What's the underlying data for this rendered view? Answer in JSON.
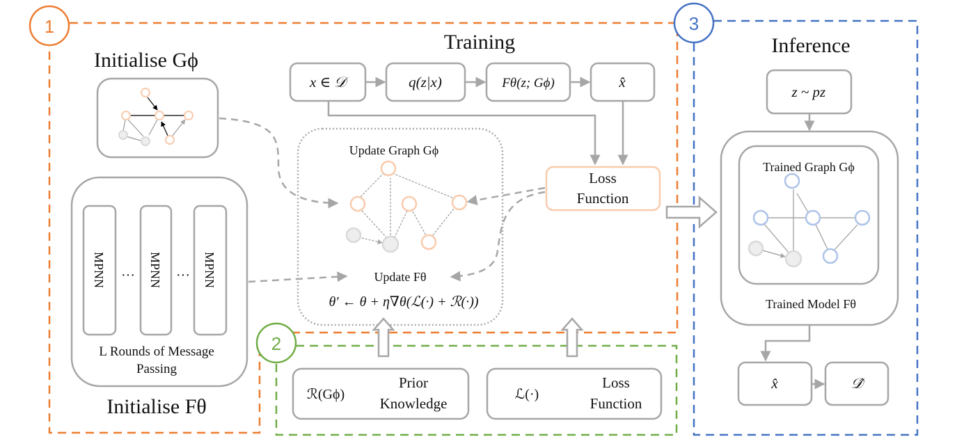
{
  "colors": {
    "stage1": "#ed7d31",
    "stage2": "#70ad47",
    "stage3": "#4472c4",
    "node_orange": "#f8cbad",
    "node_blue": "#adc3e8",
    "node_gray": "#d9d9d9",
    "line": "#a6a6a6"
  },
  "stage_numbers": [
    "1",
    "2",
    "3"
  ],
  "training": {
    "title": "Training",
    "pipeline": [
      "x ∈ 𝒟",
      "q(z|x)",
      "Fθ(z; Gϕ)",
      "x̂"
    ],
    "loss_box": [
      "Loss",
      "Function"
    ],
    "update_graph_label": "Update Graph Gϕ",
    "update_model_label": "Update Fθ",
    "update_rule": "θ′ ← θ + η∇θ(ℒ(·) + ℛ(·))"
  },
  "init": {
    "graph_title": "Initialise Gϕ",
    "model_title": "Initialise Fθ",
    "mpnn_label": "MPNN",
    "ellipsis": "···",
    "mpnn_caption": [
      "L Rounds of Message",
      "Passing"
    ]
  },
  "priors": {
    "prior": {
      "symbol": "ℛ(Gϕ)",
      "label": [
        "Prior",
        "Knowledge"
      ]
    },
    "loss": {
      "symbol": "ℒ(·)",
      "label": [
        "Loss",
        "Function"
      ]
    }
  },
  "inference": {
    "title": "Inference",
    "sample": "z ~ pᴢ",
    "graph_label": "Trained Graph Gϕ",
    "model_label": "Trained Model Fθ",
    "outputs": [
      "x̂",
      "𝒟̂"
    ]
  }
}
